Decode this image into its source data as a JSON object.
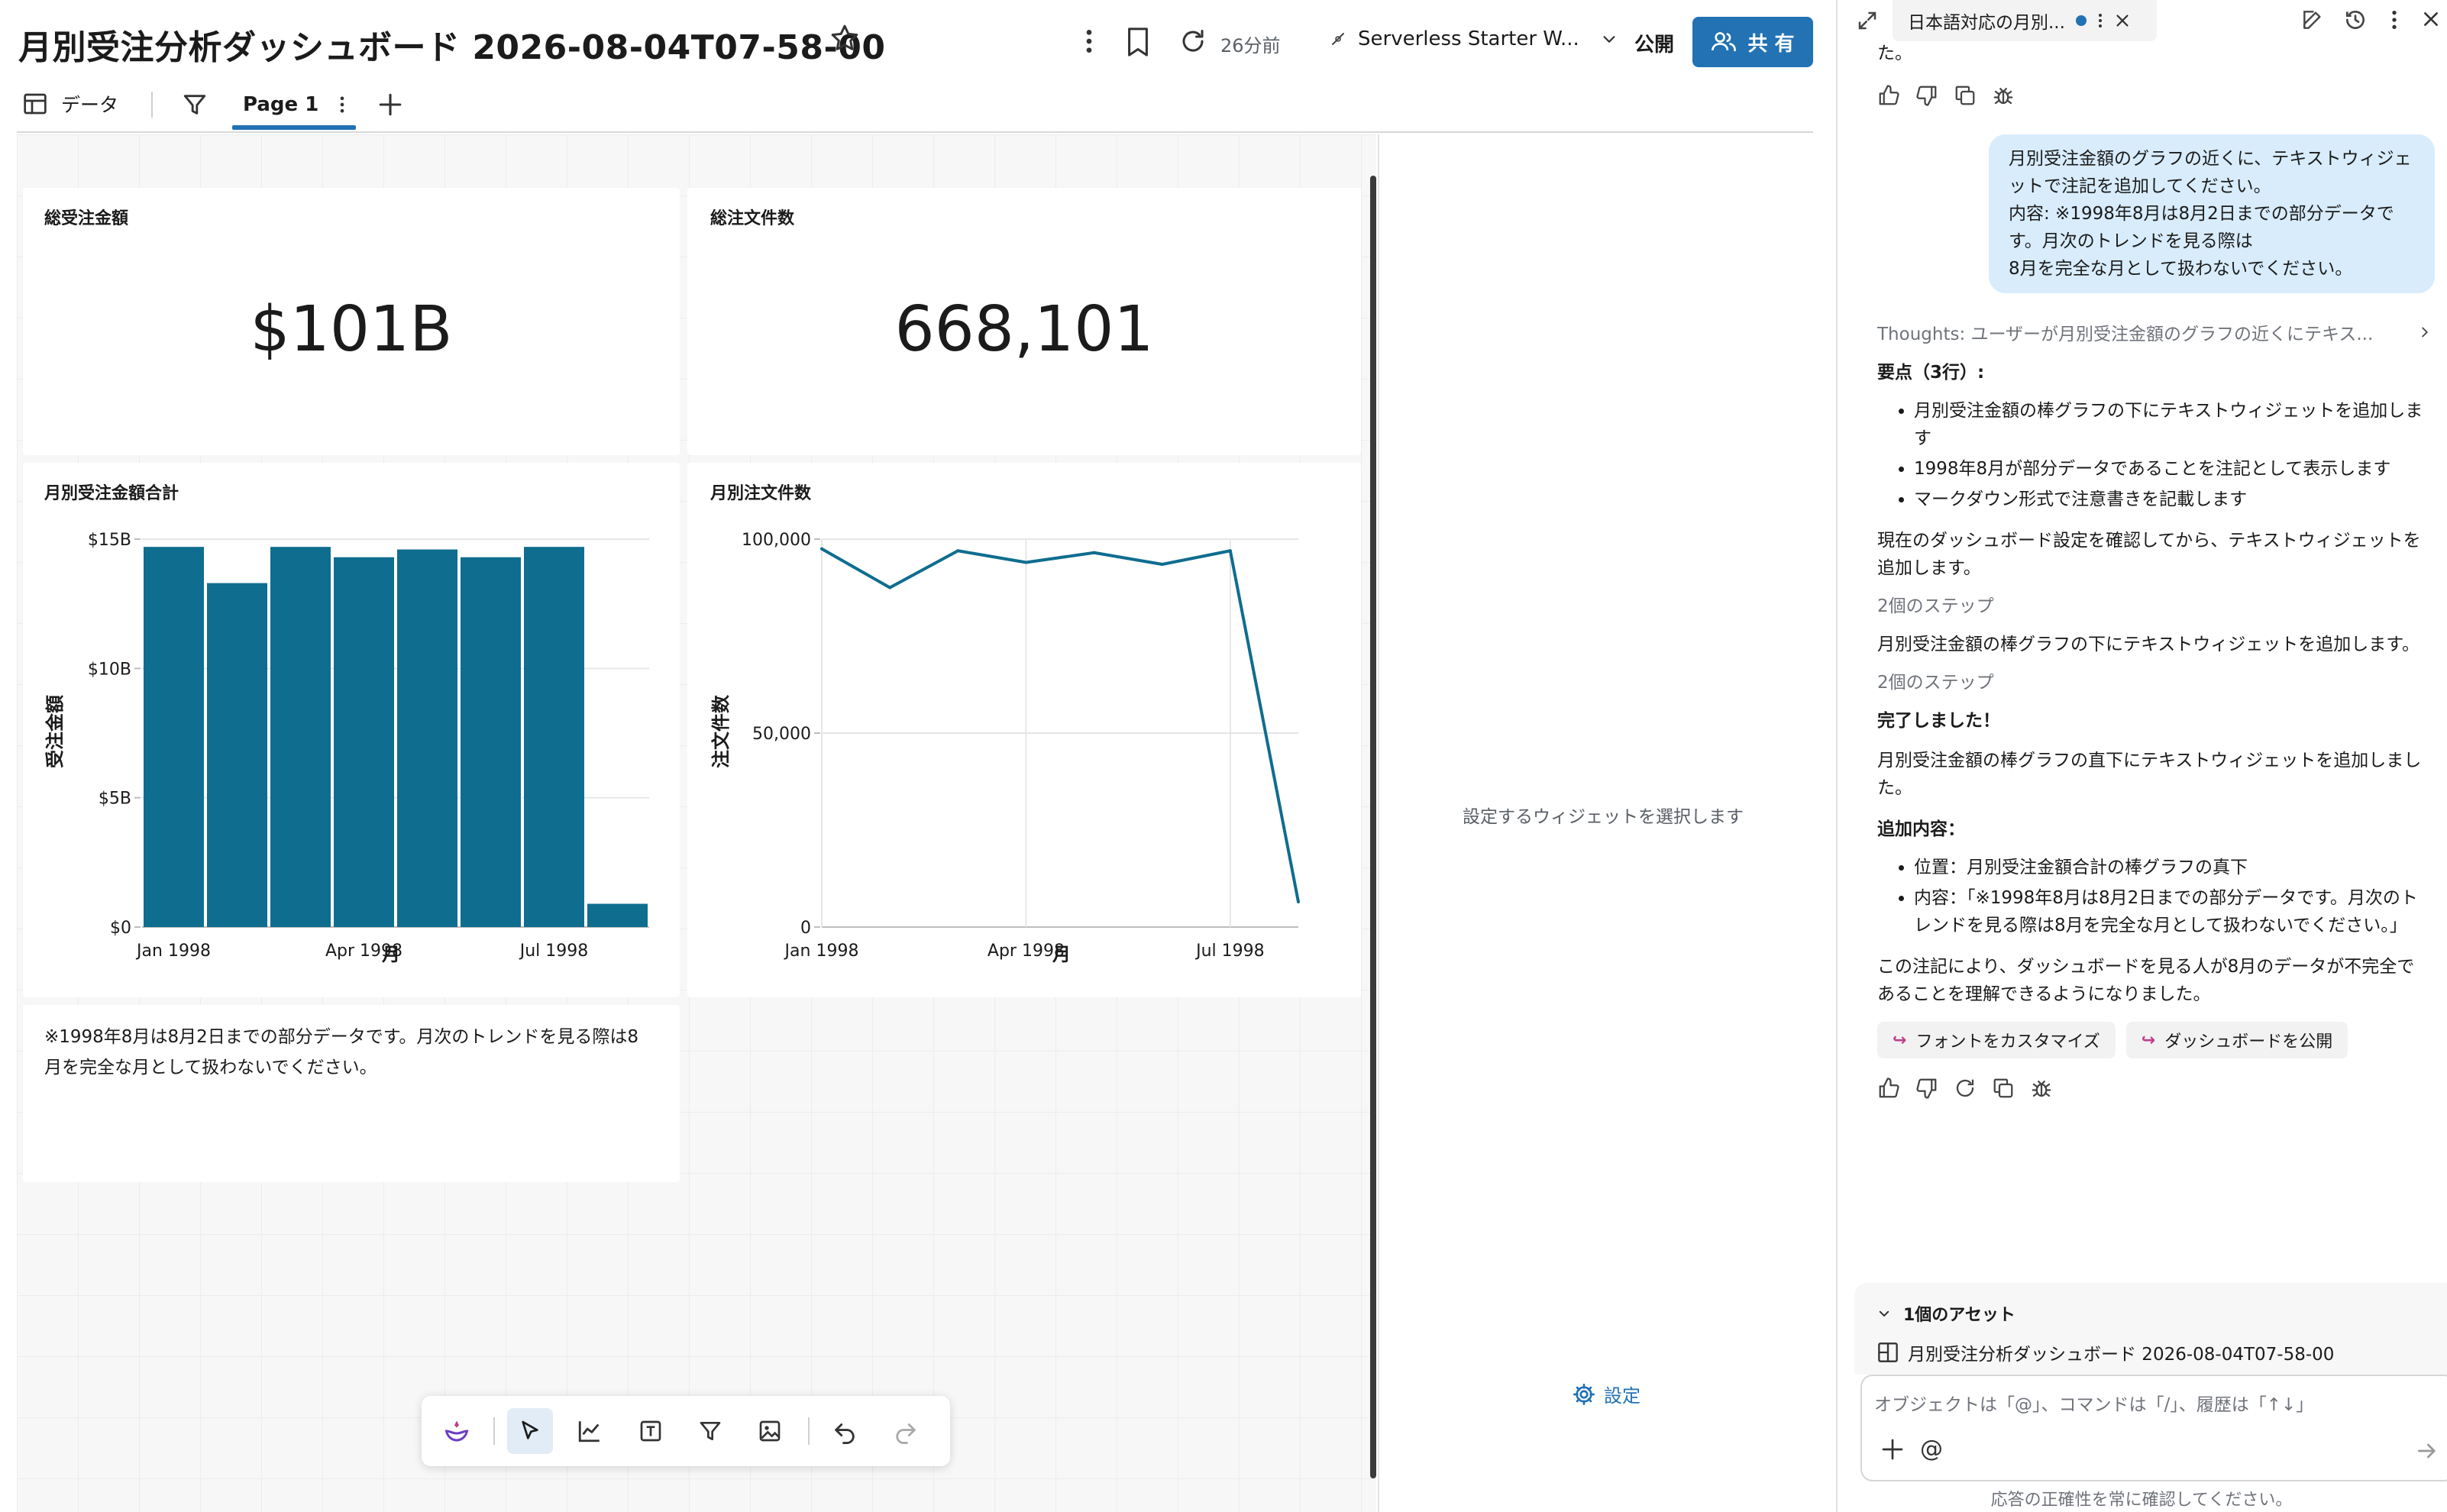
{
  "header": {
    "title": "月別受注分析ダッシュボード 2026-08-04T07-58-00",
    "refresh_time": "26分前",
    "warehouse": "Serverless Starter W...",
    "publish_label": "公開",
    "share_label": "共 有",
    "data_tab_label": "データ",
    "page_tab_label": "Page 1"
  },
  "widgets": {
    "total_amount": {
      "title": "総受注金額",
      "value": "$101B"
    },
    "total_orders": {
      "title": "総注文件数",
      "value": "668,101"
    },
    "bar_chart": {
      "title": "月別受注金額合計",
      "xlabel": "月",
      "ylabel": "受注金額",
      "yticks": [
        "$15B",
        "$10B",
        "$5B",
        "$0"
      ],
      "xticks": [
        "Jan 1998",
        "Apr 1998",
        "Jul 1998"
      ]
    },
    "line_chart": {
      "title": "月別注文件数",
      "xlabel": "月",
      "ylabel": "注文件数",
      "yticks": [
        "100,000",
        "50,000",
        "0"
      ],
      "xticks": [
        "Jan 1998",
        "Apr 1998",
        "Jul 1998"
      ]
    },
    "note_text": "※1998年8月は8月2日までの部分データです。月次のトレンドを見る際は8月を完全な月として扱わないでください。"
  },
  "chart_data": [
    {
      "type": "bar",
      "title": "月別受注金額合計",
      "xlabel": "月",
      "ylabel": "受注金額",
      "categories": [
        "1998-01",
        "1998-02",
        "1998-03",
        "1998-04",
        "1998-05",
        "1998-06",
        "1998-07",
        "1998-08"
      ],
      "values": [
        14.7,
        13.3,
        14.7,
        14.3,
        14.6,
        14.3,
        14.7,
        0.9
      ],
      "unit": "$B",
      "ylim": [
        0,
        15
      ],
      "color": "#0f6d8f",
      "grid": true
    },
    {
      "type": "line",
      "title": "月別注文件数",
      "xlabel": "月",
      "ylabel": "注文件数",
      "categories": [
        "1998-01",
        "1998-02",
        "1998-03",
        "1998-04",
        "1998-05",
        "1998-06",
        "1998-07",
        "1998-08"
      ],
      "values": [
        97500,
        87500,
        97000,
        94000,
        96500,
        93500,
        97000,
        6500
      ],
      "ylim": [
        0,
        100000
      ],
      "color": "#0f6d8f",
      "grid": true
    }
  ],
  "config_panel": {
    "placeholder": "設定するウィジェットを選択します",
    "settings_label": "設定"
  },
  "assistant": {
    "tab_title": "日本語対応の月別...",
    "cut_text": "た。",
    "user_message": "月別受注金額のグラフの近くに、テキストウィジェットで注記を追加してください。\n内容: ※1998年8月は8月2日までの部分データです。月次のトレンドを見る際は\n8月を完全な月として扱わないでください。",
    "thoughts": "Thoughts: ユーザーが月別受注金額のグラフの近くにテキス...",
    "summary_heading": "要点（3行）:",
    "summary_items": [
      "月別受注金額の棒グラフの下にテキストウィジェットを追加します",
      "1998年8月が部分データであることを注記として表示します",
      "マークダウン形式で注意書きを記載します"
    ],
    "para1": "現在のダッシュボード設定を確認してから、テキストウィジェットを追加します。",
    "steps1": "2個のステップ",
    "para2": "月別受注金額の棒グラフの下にテキストウィジェットを追加します。",
    "steps2": "2個のステップ",
    "done": "完了しました！",
    "para3": "月別受注金額の棒グラフの直下にテキストウィジェットを追加しました。",
    "added_heading": "追加内容：",
    "added_items": [
      "位置：月別受注金額合計の棒グラフの真下",
      "内容：「※1998年8月は8月2日までの部分データです。月次のトレンドを見る際は8月を完全な月として扱わないでください。」"
    ],
    "para4": "この注記により、ダッシュボードを見る人が8月のデータが不完全であることを理解できるようになりました。",
    "chip1": "フォントをカスタマイズ",
    "chip2": "ダッシュボードを公開",
    "assets_heading": "1個のアセット",
    "asset_name": "月別受注分析ダッシュボード 2026-08-04T07-58-00",
    "input_placeholder": "オブジェクトは「@」、コマンドは「/」、履歴は「↑↓」",
    "footer_note": "応答の正確性を常に確認してください。"
  },
  "colors": {
    "accent": "#2272b4",
    "chart": "#0f6d8f",
    "user_bubble": "#d8ecfb"
  }
}
